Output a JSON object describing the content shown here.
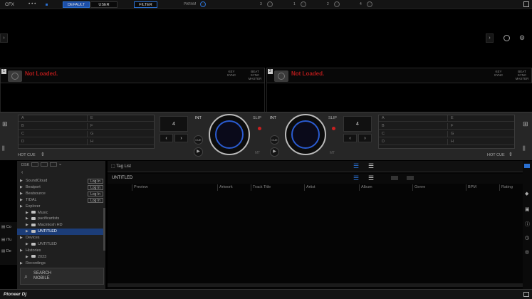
{
  "topbar": {
    "cfx": "CFX",
    "dots": "• • •",
    "default_btn": "DEFAULT",
    "user_btn": "USER",
    "filter_btn": "FILTER",
    "param_label": "PARAM",
    "fx_numbers": [
      "3",
      "1",
      "2",
      "4"
    ]
  },
  "decks": [
    {
      "number": "1",
      "status": "Not Loaded.",
      "key_sync": "KEY\nSYNC",
      "beat_sync": "BEAT\nSYNC\nMASTER"
    },
    {
      "number": "2",
      "status": "Not Loaded.",
      "key_sync": "KEY\nSYNC",
      "beat_sync": "BEAT\nSYNC\nMASTER"
    }
  ],
  "deck_controls": {
    "int": "INT",
    "slip": "SLIP",
    "beat_value": "4",
    "cue": "CUE",
    "hot_cue": "HOT CUE",
    "mt": "MT",
    "pads_left": [
      "A",
      "B",
      "C",
      "D"
    ],
    "pads_right": [
      "E",
      "F",
      "G",
      "H"
    ]
  },
  "browser": {
    "tag_list": "Tag List",
    "playlist_title": "UNTITLED",
    "columns": [
      "Preview",
      "Artwork",
      "Track Title",
      "Artist",
      "Album",
      "Genre",
      "BPM",
      "Rating"
    ],
    "dsk": "DSK"
  },
  "tree": [
    {
      "label": "SoundCloud",
      "indent": 0,
      "badge": "Log In"
    },
    {
      "label": "Beatport",
      "indent": 0,
      "badge": "Log In"
    },
    {
      "label": "Beatsource",
      "indent": 0,
      "badge": "Log In"
    },
    {
      "label": "TIDAL",
      "indent": 0,
      "badge": "Log In"
    },
    {
      "label": "Explorer",
      "indent": 0,
      "badge": ""
    },
    {
      "label": "Music",
      "indent": 1,
      "badge": ""
    },
    {
      "label": "pacificartists",
      "indent": 1,
      "badge": ""
    },
    {
      "label": "Macintosh HD",
      "indent": 1,
      "badge": ""
    },
    {
      "label": "UNTITLED",
      "indent": 1,
      "badge": "",
      "selected": true
    },
    {
      "label": "Devices",
      "indent": 0,
      "badge": ""
    },
    {
      "label": "UNTITLED",
      "indent": 1,
      "badge": ""
    },
    {
      "label": "Histories",
      "indent": 0,
      "badge": ""
    },
    {
      "label": "2023",
      "indent": 1,
      "badge": ""
    },
    {
      "label": "Recordings",
      "indent": 0,
      "badge": ""
    }
  ],
  "search_mobile": "SEARCH\nMOBILE",
  "side_tabs": [
    "Co",
    "iTu",
    "De"
  ],
  "footer_logo": "Pioneer Dj"
}
